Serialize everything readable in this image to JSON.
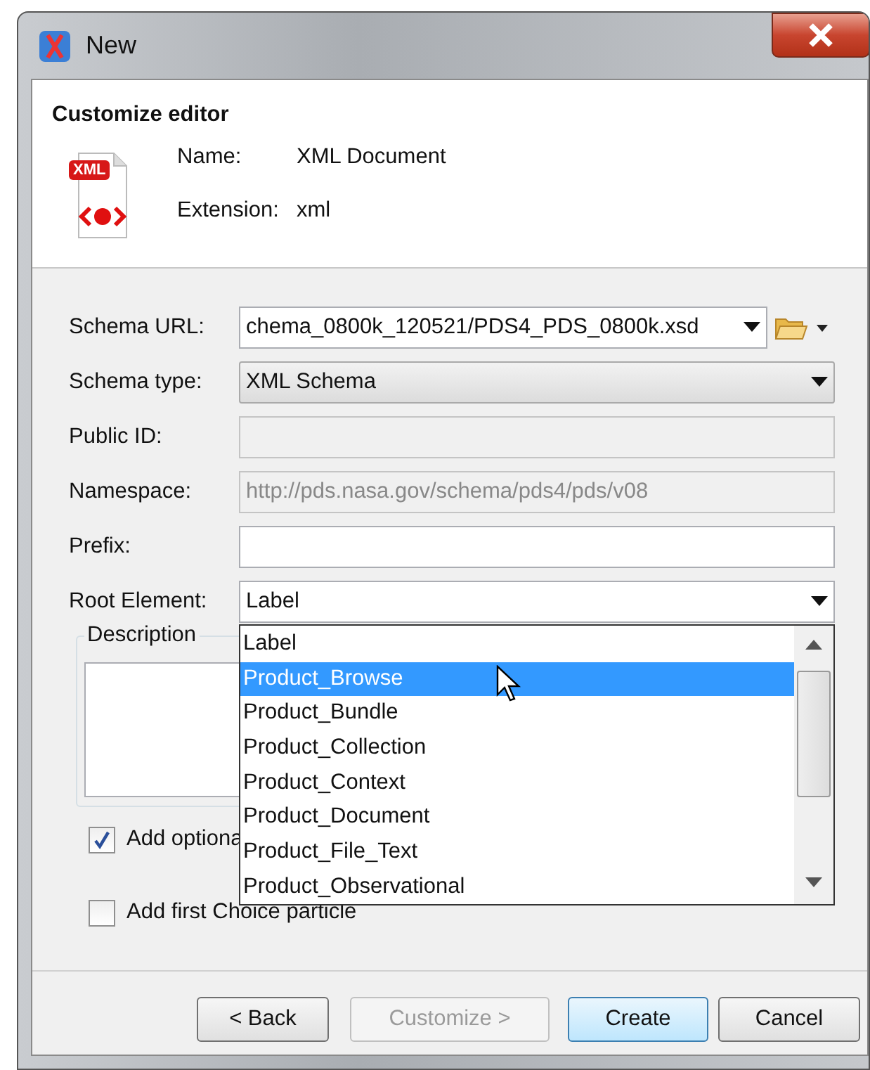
{
  "window": {
    "title": "New"
  },
  "header": {
    "title": "Customize editor",
    "badge": "XML",
    "name_label": "Name:",
    "name_value": "XML Document",
    "extension_label": "Extension:",
    "extension_value": "xml"
  },
  "fields": [
    {
      "label": "Schema URL:",
      "kind": "url-combo",
      "value": "chema_0800k_120521/PDS4_PDS_0800k.xsd",
      "disabled": false
    },
    {
      "label": "Schema type:",
      "kind": "select",
      "value": "XML Schema",
      "disabled": false
    },
    {
      "label": "Public ID:",
      "kind": "text",
      "disabled": true
    },
    {
      "label": "Namespace:",
      "kind": "text",
      "value": "http://pds.nasa.gov/schema/pds4/pds/v08",
      "disabled": true
    },
    {
      "label": "Prefix:",
      "kind": "text",
      "disabled": false
    },
    {
      "label": "Root Element:",
      "kind": "combo",
      "value": "Label",
      "disabled": false,
      "expanded": true
    }
  ],
  "dropdown": {
    "items": [
      {
        "label": "Label",
        "selected": false
      },
      {
        "label": "Product_Browse",
        "selected": true
      },
      {
        "label": "Product_Bundle",
        "selected": false
      },
      {
        "label": "Product_Collection",
        "selected": false
      },
      {
        "label": "Product_Context",
        "selected": false
      },
      {
        "label": "Product_Document",
        "selected": false
      },
      {
        "label": "Product_File_Text",
        "selected": false
      },
      {
        "label": "Product_Observational",
        "selected": false
      }
    ]
  },
  "description": {
    "title": "Description"
  },
  "checkboxes": [
    {
      "label": "Add optiona",
      "checked": true
    },
    {
      "label": "Add first Choice particle",
      "checked": false
    }
  ],
  "buttons": [
    {
      "label": "< Back",
      "disabled": false,
      "default": false
    },
    {
      "label": "Customize >",
      "disabled": true,
      "default": false
    },
    {
      "label": "Create",
      "disabled": false,
      "default": true
    },
    {
      "label": "Cancel",
      "disabled": false,
      "default": false
    }
  ]
}
